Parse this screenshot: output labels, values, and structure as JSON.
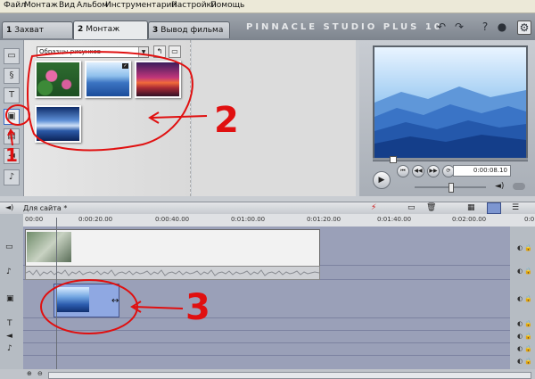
{
  "menu": {
    "items": [
      "Файл",
      "Монтаж",
      "Вид",
      "Альбом",
      "Инструментарий",
      "Настройки",
      "Помощь"
    ]
  },
  "tabs": [
    {
      "number": "1",
      "label": "Захват"
    },
    {
      "number": "2",
      "label": "Монтаж"
    },
    {
      "number": "3",
      "label": "Вывод фильма"
    }
  ],
  "brand": "PINNACLE STUDIO PLUS 10",
  "album": {
    "selected_album": "Образцы рисунков",
    "thumbnails": [
      "lotus",
      "mountains-blue",
      "sunset-sky",
      "blue-texture"
    ]
  },
  "player": {
    "timecode": "0:00:08.10"
  },
  "timeline": {
    "project_name": "Для сайта *",
    "ruler_labels": [
      "00:00",
      "0:00:20.00",
      "0:00:40.00",
      "0:01:00.00",
      "0:01:20.00",
      "0:01:40.00",
      "0:02:00.00",
      "0:0"
    ]
  },
  "annotations": {
    "label_1": "1",
    "label_2": "2",
    "label_3": "3"
  },
  "colors": {
    "annotation": "#e01010",
    "preview_blue": "#2b5fb0",
    "title_clip": "#8fa8e2"
  },
  "icons": [
    "undo-icon",
    "redo-icon",
    "help-icon",
    "hint-icon",
    "settings-icon",
    "play-icon",
    "rewind-icon",
    "fast-forward-icon",
    "loop-icon",
    "volume-icon",
    "trash-icon",
    "split-icon"
  ]
}
